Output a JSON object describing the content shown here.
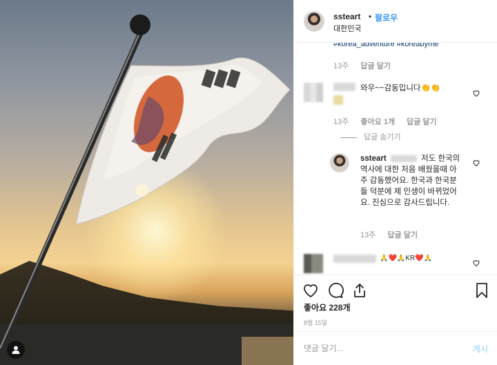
{
  "post": {
    "username": "ssteart",
    "separator": "•",
    "follow_label": "팔로우",
    "location": "대한민국",
    "hashtags": "#korea_adventure #koreabyme"
  },
  "caption_meta": {
    "time": "13주",
    "reply": "답글 달기"
  },
  "comments": [
    {
      "text": "와우~~감동입니다👏👏",
      "time": "13주",
      "likes": "좋아요 1개",
      "reply": "답글 달기",
      "hide_replies": "답글 숨기기"
    },
    {
      "username": "ssteart",
      "text": "저도 한국의 역사에 대한 처음 배웠을때 아주 감동했어요. 한국과 한국분들 덕분에 제 인생이 바뀌었어요. 진심으로 감사드립니다.",
      "time": "13주",
      "reply": "답글 달기"
    },
    {
      "text": "🙏❤️🙏KR❤️🙏"
    }
  ],
  "actions": {
    "likes": "좋아요 228개",
    "date": "8월 15일"
  },
  "composer": {
    "placeholder": "댓글 달기...",
    "post_label": "게시"
  },
  "colors": {
    "accent": "#3897f0",
    "post_disabled": "#b2dffc",
    "hashtag": "#003569",
    "muted": "#999999"
  },
  "icons": [
    "heart-icon",
    "comment-icon",
    "share-icon",
    "bookmark-icon",
    "user-tag-icon"
  ]
}
